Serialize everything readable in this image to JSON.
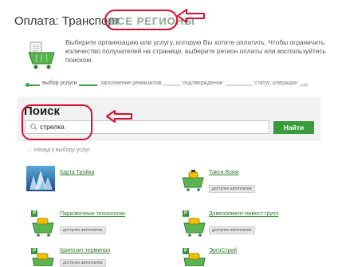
{
  "header": {
    "title": "Оплата: Транспорт",
    "region_link": "ВСЕ РЕГИОНЫ"
  },
  "hint": {
    "text": "Выберите организацию или услугу, которую Вы хотите оплатить. Чтобы ограничить количество получателей на странице, выберите регион оплаты или воспользуйтесь поиском."
  },
  "steps": [
    {
      "label": "выбор услуги"
    },
    {
      "label": "заполнение реквизитов"
    },
    {
      "label": "подтверждение"
    },
    {
      "label": "статус операции"
    }
  ],
  "search": {
    "heading": "Поиск",
    "value": "стрелка",
    "button_label": "Найти"
  },
  "back_link": "← Назад к выбору услуг",
  "providers": [
    {
      "name": "Карта Тройка"
    },
    {
      "name": "Такси Вояж",
      "badge": "доступен автоплатеж"
    },
    {
      "name": "Парковочные технологии",
      "badge": "доступен автоплатеж"
    },
    {
      "name": "Девелопмент-инвест групп",
      "badge": "доступен автоплатеж"
    },
    {
      "name": "Крипозит терминал",
      "badge": "доступен автоплатеж"
    },
    {
      "name": "ЭргоСтрой"
    }
  ],
  "colors": {
    "accent_green": "#3a9a3c",
    "annotation_red": "#d3102f",
    "link_green": "#2f7a30"
  }
}
